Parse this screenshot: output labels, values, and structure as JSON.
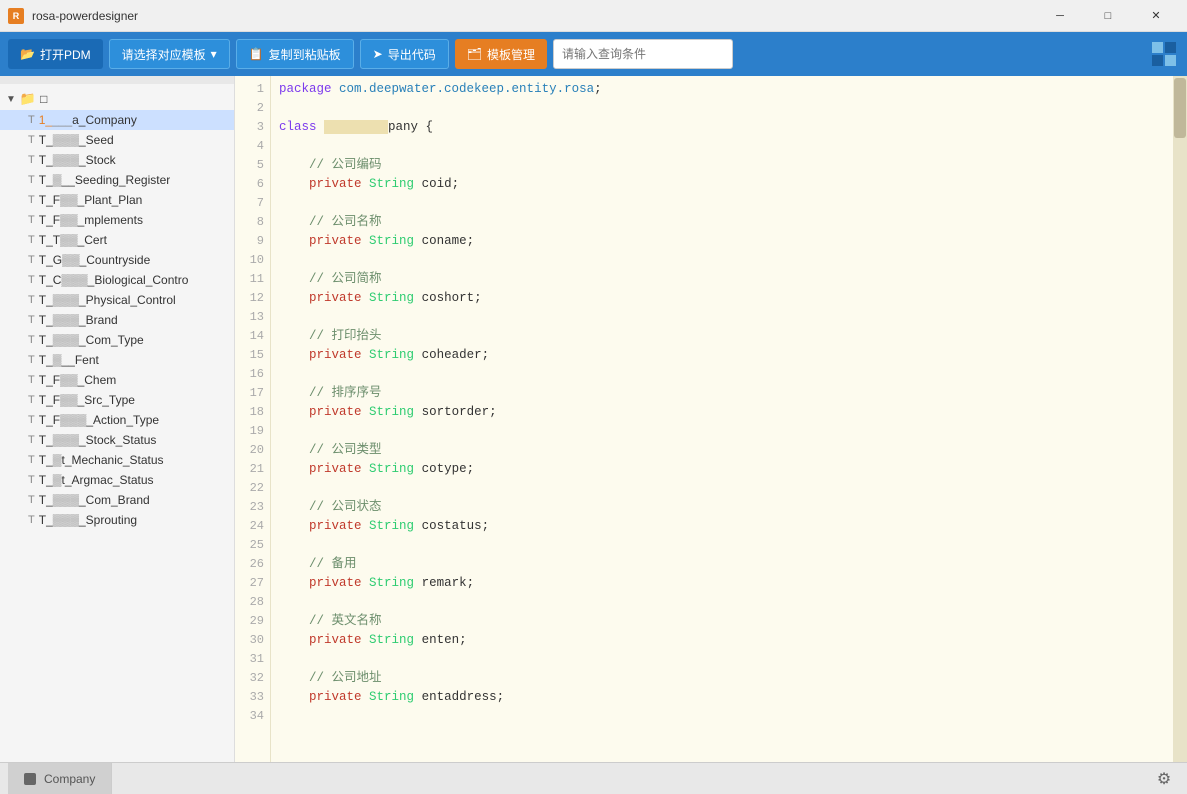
{
  "titlebar": {
    "icon": "R",
    "title": "rosa-powerdesigner",
    "minimize": "─",
    "maximize": "□",
    "close": "✕"
  },
  "toolbar": {
    "btn_open": "打开PDM",
    "btn_select": "请选择对应模板",
    "btn_copy": "复制到粘贴板",
    "btn_export": "导出代码",
    "btn_template": "模板管理",
    "search_placeholder": "请输入查询条件"
  },
  "sidebar": {
    "root_label": "",
    "items": [
      {
        "label": "T_   _a_Company",
        "highlight": true,
        "selected": true
      },
      {
        "label": "T_   _Seed"
      },
      {
        "label": "T_   _Stock"
      },
      {
        "label": "T_   _Seeding_Register"
      },
      {
        "label": "T_F   _Plant_Plan"
      },
      {
        "label": "T_F   _mplements"
      },
      {
        "label": "T_T   _Cert"
      },
      {
        "label": "T_G   _Countryside"
      },
      {
        "label": "T_C   _Biological_Contro"
      },
      {
        "label": "T_   _Physical_Control"
      },
      {
        "label": "T_   _Brand"
      },
      {
        "label": "T_   _Com_Type"
      },
      {
        "label": "T_   _Fent"
      },
      {
        "label": "T_F   _Chem"
      },
      {
        "label": "T_F   _Src_Type"
      },
      {
        "label": "T_F   _Action_Type"
      },
      {
        "label": "T_   _Stock_Status"
      },
      {
        "label": "T_   t_Mechanic_Status"
      },
      {
        "label": "T_   t_Argmac_Status"
      },
      {
        "label": "T_   _Com_Brand"
      },
      {
        "label": "T_   _Sprouting"
      }
    ]
  },
  "code": {
    "lines": [
      {
        "num": 1,
        "content": "package com.deepwater.codekeep.entity.rosa;"
      },
      {
        "num": 2,
        "content": ""
      },
      {
        "num": 3,
        "content": "class           pany {"
      },
      {
        "num": 4,
        "content": ""
      },
      {
        "num": 5,
        "content": "    // 公司编码"
      },
      {
        "num": 6,
        "content": "    private String coid;"
      },
      {
        "num": 7,
        "content": ""
      },
      {
        "num": 8,
        "content": "    // 公司名称"
      },
      {
        "num": 9,
        "content": "    private String coname;"
      },
      {
        "num": 10,
        "content": ""
      },
      {
        "num": 11,
        "content": "    // 公司简称"
      },
      {
        "num": 12,
        "content": "    private String coshort;"
      },
      {
        "num": 13,
        "content": ""
      },
      {
        "num": 14,
        "content": "    // 打印抬头"
      },
      {
        "num": 15,
        "content": "    private String coheader;"
      },
      {
        "num": 16,
        "content": ""
      },
      {
        "num": 17,
        "content": "    // 排序序号"
      },
      {
        "num": 18,
        "content": "    private String sortorder;"
      },
      {
        "num": 19,
        "content": ""
      },
      {
        "num": 20,
        "content": "    // 公司类型"
      },
      {
        "num": 21,
        "content": "    private String cotype;"
      },
      {
        "num": 22,
        "content": ""
      },
      {
        "num": 23,
        "content": "    // 公司状态"
      },
      {
        "num": 24,
        "content": "    private String costatus;"
      },
      {
        "num": 25,
        "content": ""
      },
      {
        "num": 26,
        "content": "    // 备用"
      },
      {
        "num": 27,
        "content": "    private String remark;"
      },
      {
        "num": 28,
        "content": ""
      },
      {
        "num": 29,
        "content": "    // 英文名称"
      },
      {
        "num": 30,
        "content": "    private String enten;"
      },
      {
        "num": 31,
        "content": ""
      },
      {
        "num": 32,
        "content": "    // 公司地址"
      },
      {
        "num": 33,
        "content": "    private String entaddress;"
      },
      {
        "num": 34,
        "content": ""
      }
    ]
  },
  "statusbar": {
    "tab_label": "Company",
    "gear_icon": "⚙"
  }
}
